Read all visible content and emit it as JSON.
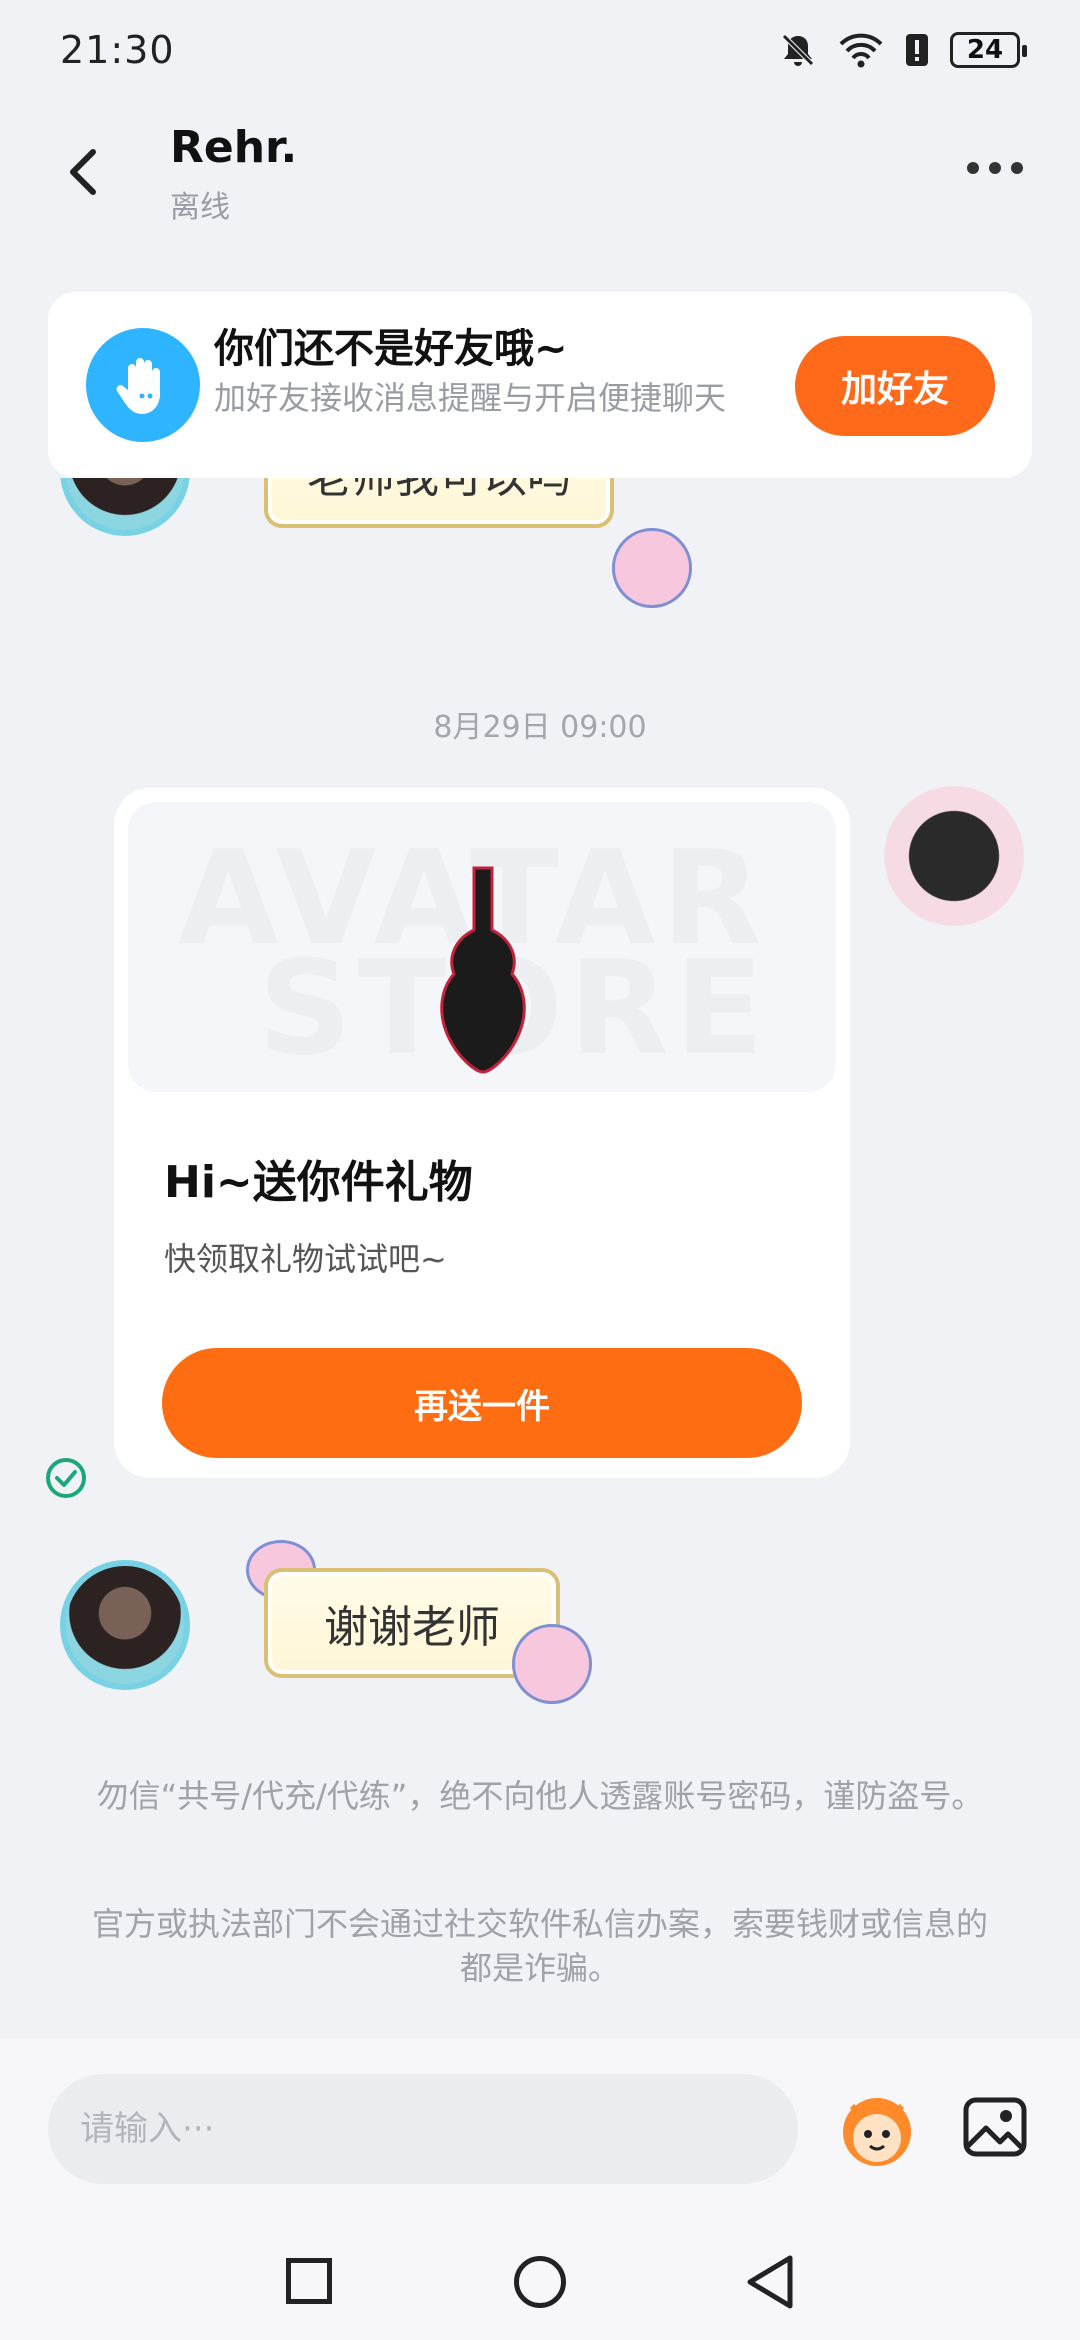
{
  "status_bar": {
    "time": "21:30",
    "battery": "24"
  },
  "header": {
    "name": "Rehr.",
    "status": "离线"
  },
  "friend_banner": {
    "title": "你们还不是好友哦~",
    "description": "加好友接收消息提醒与开启便捷聊天",
    "button_label": "加好友"
  },
  "messages": {
    "partial_sticker_text": "老师我可以吗",
    "timestamp": "8月29日 09:00",
    "gift_card": {
      "image_watermark_top": "AVATAR",
      "image_watermark_bottom": "STORE",
      "title": "Hi~送你件礼物",
      "description": "快领取礼物试试吧~",
      "button_label": "再送一件"
    },
    "reply_sticker_text": "谢谢老师"
  },
  "notices": [
    "勿信“共号/代充/代练”，绝不向他人透露账号密码，谨防盗号。",
    "官方或执法部门不会通过社交软件私信办案，索要钱财或信息的都是诈骗。"
  ],
  "input": {
    "placeholder": "请输入···"
  },
  "colors": {
    "accent": "#ff6a1a",
    "banner_icon": "#2fb5ff",
    "check": "#1aa87a"
  }
}
